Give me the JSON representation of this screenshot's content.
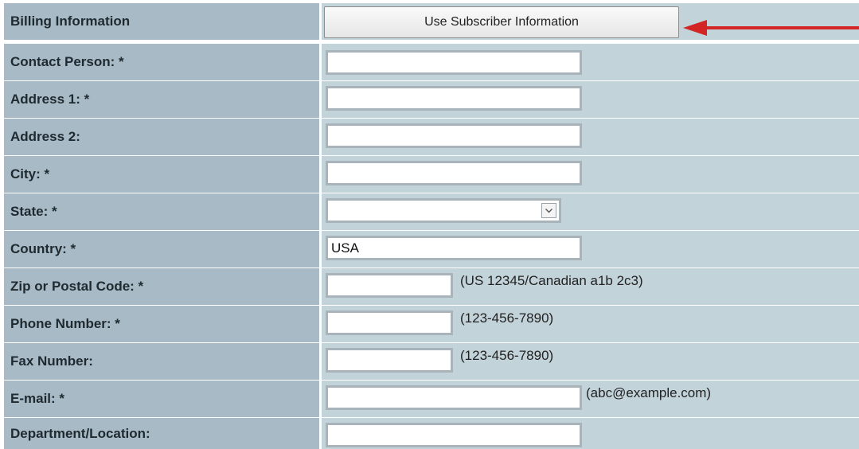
{
  "header": {
    "label": "Billing Information",
    "button_label": "Use Subscriber Information"
  },
  "fields": {
    "contact": {
      "label": "Contact Person: *",
      "value": ""
    },
    "address1": {
      "label": "Address 1: *",
      "value": ""
    },
    "address2": {
      "label": "Address 2:",
      "value": ""
    },
    "city": {
      "label": "City: *",
      "value": ""
    },
    "state": {
      "label": "State: *",
      "value": ""
    },
    "country": {
      "label": "Country: *",
      "value": "USA"
    },
    "zip": {
      "label": "Zip or Postal Code: *",
      "value": "",
      "hint": "(US 12345/Canadian a1b 2c3)"
    },
    "phone": {
      "label": "Phone Number: *",
      "value": "",
      "hint": "(123-456-7890)"
    },
    "fax": {
      "label": "Fax Number:",
      "value": "",
      "hint": "(123-456-7890)"
    },
    "email": {
      "label": "E-mail: *",
      "value": "",
      "hint": "(abc@example.com)"
    },
    "department": {
      "label": "Department/Location:",
      "value": ""
    }
  },
  "icons": {
    "select_arrow": "chevron-down-icon",
    "annotation": "red-arrow-pointing-left"
  },
  "colors": {
    "label_cell": "#a7bac5",
    "value_cell": "#c3d3da",
    "annotation_arrow": "#d42525"
  }
}
